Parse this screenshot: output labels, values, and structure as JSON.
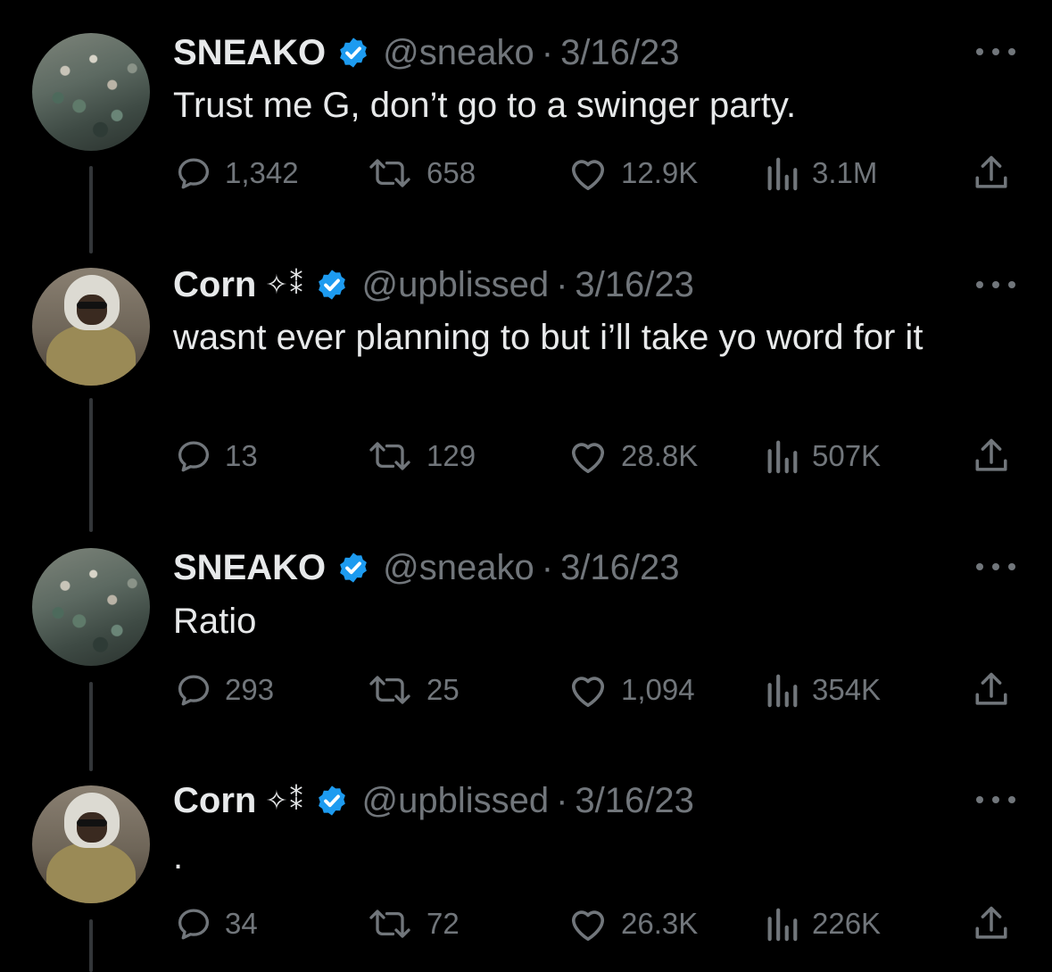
{
  "tweets": [
    {
      "name": "SNEAKO",
      "name_suffix": "",
      "handle": "@sneako",
      "separator": "·",
      "date": "3/16/23",
      "text": "Trust me G, don’t go to a swinger party.",
      "replies": "1,342",
      "retweets": "658",
      "likes": "12.9K",
      "views": "3.1M",
      "avatar": "crowd-photo"
    },
    {
      "name": "Corn",
      "name_suffix": "✧⁑",
      "handle": "@upblissed",
      "separator": "·",
      "date": "3/16/23",
      "text": "wasnt ever planning to but i’ll take yo word for it",
      "replies": "13",
      "retweets": "129",
      "likes": "28.8K",
      "views": "507K",
      "avatar": "hooded-person-photo"
    },
    {
      "name": "SNEAKO",
      "name_suffix": "",
      "handle": "@sneako",
      "separator": "·",
      "date": "3/16/23",
      "text": "Ratio",
      "replies": "293",
      "retweets": "25",
      "likes": "1,094",
      "views": "354K",
      "avatar": "crowd-photo"
    },
    {
      "name": "Corn",
      "name_suffix": "✧⁑",
      "handle": "@upblissed",
      "separator": "·",
      "date": "3/16/23",
      "text": ".",
      "replies": "34",
      "retweets": "72",
      "likes": "26.3K",
      "views": "226K",
      "avatar": "hooded-person-photo"
    }
  ],
  "colors": {
    "background": "#000000",
    "text_primary": "#e7e9ea",
    "text_secondary": "#71767b",
    "verified_blue": "#1d9bf0",
    "thread_line": "#333639"
  },
  "icons": [
    "verified-badge-icon",
    "more-icon",
    "reply-icon",
    "retweet-icon",
    "like-icon",
    "views-icon",
    "share-icon"
  ]
}
